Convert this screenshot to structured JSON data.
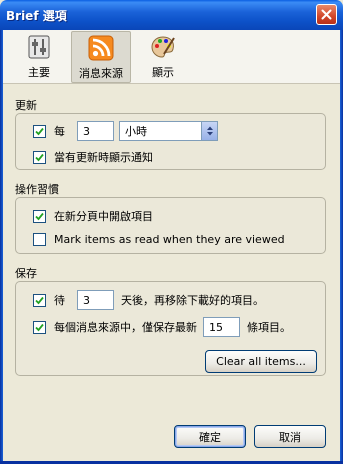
{
  "window": {
    "title": "Brief 選項"
  },
  "toolbar": {
    "items": [
      {
        "label": "主要",
        "icon": "slider-settings-icon",
        "active": false
      },
      {
        "label": "消息來源",
        "icon": "rss-feed-icon",
        "active": true
      },
      {
        "label": "顯示",
        "icon": "palette-icon",
        "active": false
      }
    ]
  },
  "update": {
    "heading": "更新",
    "every_label": "每",
    "every_value": "3",
    "unit_value": "小時",
    "every_checked": true,
    "notify_label": "當有更新時顯示通知",
    "notify_checked": true
  },
  "habits": {
    "heading": "操作習慣",
    "newtab_label": "在新分頁中開啟項目",
    "newtab_checked": true,
    "mark_read_label": "Mark items as read when they are viewed",
    "mark_read_checked": false
  },
  "storage": {
    "heading": "保存",
    "wait_prefix": "待",
    "wait_value": "3",
    "wait_suffix": "天後，再移除下載好的項目。",
    "wait_checked": true,
    "keep_prefix": "每個消息來源中，僅保存最新",
    "keep_value": "15",
    "keep_suffix": "條項目。",
    "keep_checked": true,
    "clear_label": "Clear all items..."
  },
  "buttons": {
    "ok": "確定",
    "cancel": "取消"
  },
  "colors": {
    "titlebar": "#0a5fe2",
    "dialog_bg": "#ece9d8",
    "check": "#21a121"
  }
}
